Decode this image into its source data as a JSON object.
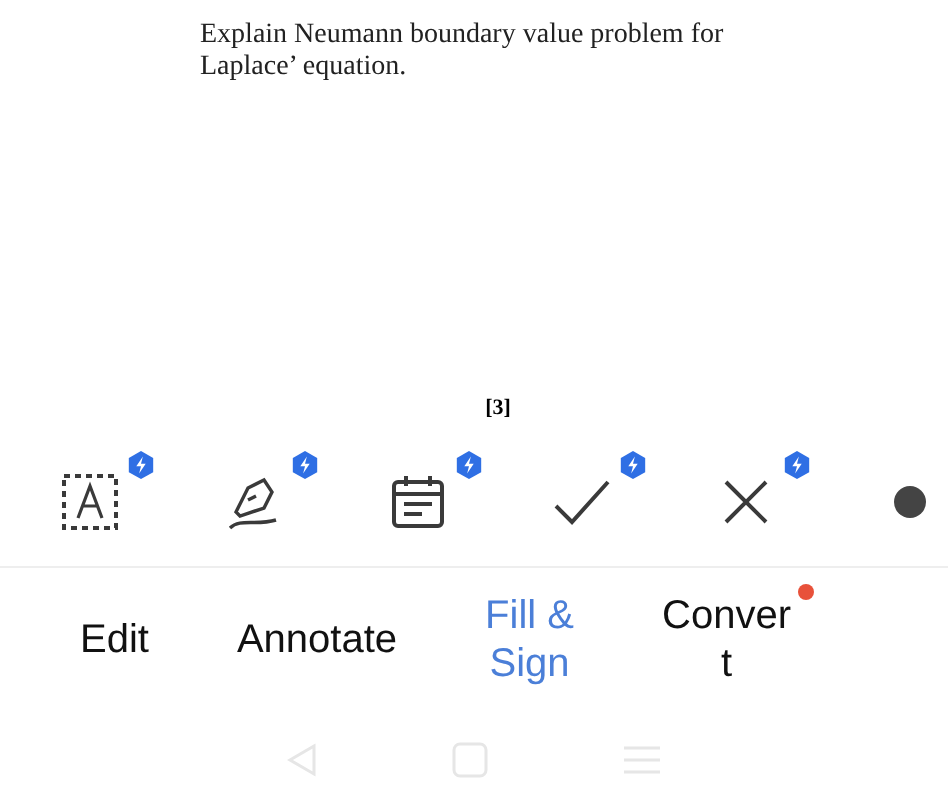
{
  "document": {
    "question": "Explain Neumann boundary value problem for Laplace’ equation.",
    "marks": "[3]"
  },
  "tools": [
    {
      "kind": "text-box",
      "premium": true
    },
    {
      "kind": "pen",
      "premium": true
    },
    {
      "kind": "date",
      "premium": true
    },
    {
      "kind": "check",
      "premium": true
    },
    {
      "kind": "cross",
      "premium": true
    },
    {
      "kind": "dot"
    }
  ],
  "tabs": [
    {
      "lines": [
        "Edit"
      ],
      "selected": false,
      "new": false
    },
    {
      "lines": [
        "Annotate"
      ],
      "selected": false,
      "new": false
    },
    {
      "lines": [
        "Fill &",
        "Sign"
      ],
      "selected": true,
      "new": false
    },
    {
      "lines": [
        "Conver",
        "t"
      ],
      "selected": false,
      "new": true
    }
  ]
}
